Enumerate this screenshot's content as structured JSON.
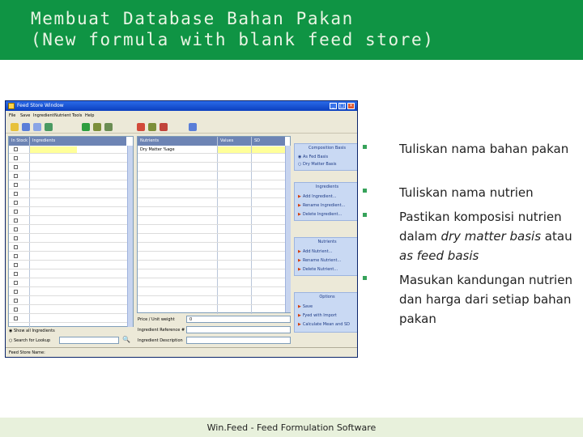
{
  "slide": {
    "title_line1": "Membuat Database Bahan Pakan",
    "title_line2": "(New formula with blank feed store)",
    "footer": "Win.Feed - Feed Formulation Software",
    "colors": {
      "banner": "#0f9444",
      "bullet": "#36a25a",
      "footer_bg": "#e8f1dc"
    }
  },
  "window": {
    "title": "Feed Store Window",
    "menus": [
      "File",
      "Save",
      "Ingredient",
      "Nutrient",
      "Tools",
      "Help"
    ],
    "columns": {
      "in_stock": "In Stock",
      "ingredients": "Ingredients",
      "nutrients": "Nutrients",
      "values": "Values",
      "sd": "SD"
    },
    "first_nutrient": "Dry Matter %age",
    "price_label": "Price / Unit weight",
    "price_value": "0",
    "ref_label": "Ingredient Reference #",
    "desc_label": "Ingredient Description",
    "show_all": "Show all Ingredients",
    "search_label": "Search for Lookup",
    "status": "Feed Store Name:",
    "search_icon": "search-icon",
    "side": {
      "composition": {
        "title": "Composition Basis",
        "opt1": "As Fed Basis",
        "opt2": "Dry Matter Basis"
      },
      "ingredients": {
        "title": "Ingredients",
        "items": [
          "Add Ingredient...",
          "Rename Ingredient...",
          "Delete Ingredient..."
        ]
      },
      "nutrients": {
        "title": "Nutrients",
        "items": [
          "Add Nutrient...",
          "Rename Nutrient...",
          "Delete Nutrient..."
        ]
      },
      "options": {
        "title": "Options",
        "items": [
          "Save",
          "Fyed with Import",
          "Calculate Mean and SD"
        ]
      }
    }
  },
  "bullets": {
    "b1": "Tuliskan nama bahan pakan",
    "b2": "Tuliskan nama nutrien",
    "b3_pre": "Pastikan komposisi nutrien dalam ",
    "b3_em1": "dry matter basis",
    "b3_mid": " atau ",
    "b3_em2": "as feed basis",
    "b4": "Masukan kandungan nutrien dan harga dari setiap bahan pakan"
  }
}
